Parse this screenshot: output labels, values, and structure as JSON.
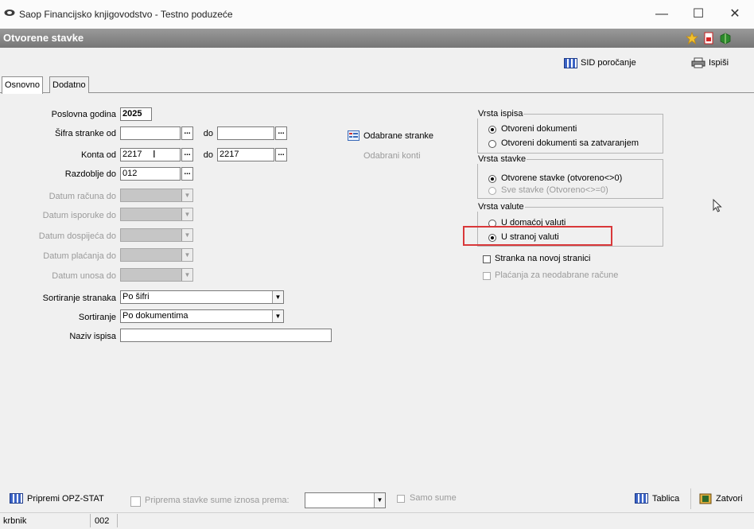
{
  "window": {
    "title": "Saop Financijsko knjigovodstvo - Testno poduzeće",
    "minimize": "—",
    "maximize": "☐",
    "close": "✕"
  },
  "form": {
    "title": "Otvorene stavke"
  },
  "toolbar": {
    "sid_label": "SID poročanje",
    "print_label": "Ispiši"
  },
  "tabs": [
    {
      "label": "Osnovno",
      "active": true
    },
    {
      "label": "Dodatno",
      "active": false
    }
  ],
  "fields": {
    "poslovna_godina": {
      "label": "Poslovna godina",
      "value": "2025"
    },
    "sifra_stranke": {
      "label": "Šifra stranke od",
      "from": "",
      "to_label": "do",
      "to": ""
    },
    "konta": {
      "label": "Konta od",
      "from": "2217",
      "to_label": "do",
      "to": "2217"
    },
    "razdoblje": {
      "label": "Razdoblje do",
      "value": "012"
    },
    "datum_racuna": {
      "label": "Datum računa do"
    },
    "datum_isporuke": {
      "label": "Datum isporuke do"
    },
    "datum_dospijeca": {
      "label": "Datum dospijeća do"
    },
    "datum_placanja": {
      "label": "Datum plaćanja do"
    },
    "datum_unosa": {
      "label": "Datum unosa do"
    },
    "sortiranje_stranaka": {
      "label": "Sortiranje stranaka",
      "value": "Po šifri"
    },
    "sortiranje": {
      "label": "Sortiranje",
      "value": "Po dokumentima"
    },
    "naziv_ispisa": {
      "label": "Naziv ispisa",
      "value": ""
    }
  },
  "ellipsis": "...",
  "dropdown_arrow": "▼",
  "middle": {
    "odabrane_stranke": "Odabrane stranke",
    "odabrani_konti": "Odabrani konti"
  },
  "groups": {
    "vrsta_ispisa": {
      "title": "Vrsta ispisa",
      "options": [
        "Otvoreni dokumenti",
        "Otvoreni dokumenti sa zatvaranjem"
      ]
    },
    "vrsta_stavke": {
      "title": "Vrsta stavke",
      "options": [
        "Otvorene stavke (otvoreno<>0)",
        "Sve stavke (Otvoreno<>=0)"
      ]
    },
    "vrsta_valute": {
      "title": "Vrsta valute",
      "options": [
        "U domaćoj valuti",
        "U stranoj valuti"
      ]
    }
  },
  "checkboxes": {
    "stranka_nova_stranica": "Stranka na novoj stranici",
    "placanja_neodabrane": "Plaćanja za neodabrane račune"
  },
  "bottom": {
    "pripremi_opz": "Pripremi OPZ-STAT",
    "priprema_stavke": "Priprema stavke sume iznosa prema:",
    "samo_sume": "Samo sume",
    "tablica": "Tablica",
    "zatvori": "Zatvori"
  },
  "status": {
    "user": "krbnik",
    "code": "002"
  },
  "colors": {
    "highlight_box": "#d9383a",
    "form_header": "#808080"
  }
}
